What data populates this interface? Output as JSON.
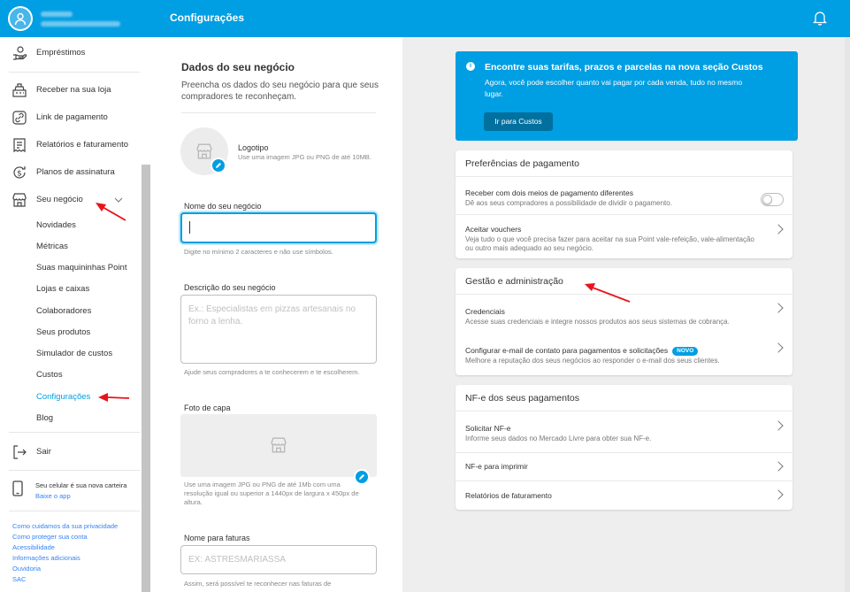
{
  "sidebar": {
    "items": [
      {
        "label": "Empréstimos",
        "icon": "hand-coin-icon"
      },
      {
        "label": "Receber na sua loja",
        "icon": "cash-register-icon"
      },
      {
        "label": "Link de pagamento",
        "icon": "link-icon"
      },
      {
        "label": "Relatórios e faturamento",
        "icon": "report-icon"
      },
      {
        "label": "Planos de assinatura",
        "icon": "dollar-cycle-icon"
      },
      {
        "label": "Seu negócio",
        "icon": "store-icon"
      }
    ],
    "sub_items": [
      "Novidades",
      "Métricas",
      "Suas maquininhas Point",
      "Lojas e caixas",
      "Colaboradores",
      "Seus produtos",
      "Simulador de custos",
      "Custos",
      "Configurações",
      "Blog"
    ],
    "active_sub": "Configurações",
    "logout_label": "Sair",
    "phone_promo": {
      "title": "Seu celular é sua nova carteira",
      "link": "Baixe o app"
    },
    "footer_links": [
      "Como cuidamos da sua privacidade",
      "Como proteger sua conta",
      "Acessibilidade",
      "Informações adicionais",
      "Ouvidoria",
      "SAC"
    ]
  },
  "header": {
    "title": "Configurações"
  },
  "form": {
    "title": "Dados do seu negócio",
    "subtitle": "Preencha os dados do seu negócio para que seus compradores te reconheçam.",
    "logo": {
      "label": "Logotipo",
      "help": "Use uma imagem JPG ou PNG de até 10MB."
    },
    "business_name": {
      "label": "Nome do seu negócio",
      "value": "",
      "help": "Digite no mínimo 2 caracteres e não use símbolos."
    },
    "description": {
      "label": "Descrição do seu negócio",
      "placeholder": "Ex.: Especialistas em pizzas artesanais no forno a lenha.",
      "help": "Ajude seus compradores a te conhecerem e te escolherem."
    },
    "cover": {
      "label": "Foto de capa",
      "help": "Use uma imagem JPG ou PNG de até 1Mb com uma resolução igual ou superior a 1440px de largura x 450px de altura."
    },
    "invoice_name": {
      "label": "Nome para faturas",
      "placeholder": "EX: ASTRESMARIASSA",
      "help": "Assim, será possível te reconhecer nas faturas de"
    }
  },
  "banner": {
    "title": "Encontre suas tarifas, prazos e parcelas na nova seção Custos",
    "text": "Agora, você pode escolher quanto vai pagar por cada venda, tudo no mesmo lugar.",
    "button": "Ir para Custos"
  },
  "payment_prefs": {
    "title": "Preferências de pagamento",
    "rows": [
      {
        "title": "Receber com dois meios de pagamento diferentes",
        "desc": "Dê aos seus compradores a possibilidade de dividir o pagamento.",
        "toggle": false
      },
      {
        "title": "Aceitar vouchers",
        "desc": "Veja tudo o que você precisa fazer para aceitar na sua Point vale-refeição, vale-alimentação ou outro mais adequado ao seu negócio."
      }
    ]
  },
  "management": {
    "title": "Gestão e administração",
    "rows": [
      {
        "title": "Credenciais",
        "desc": "Acesse suas credenciais e integre nossos produtos aos seus sistemas de cobrança."
      },
      {
        "title": "Configurar e-mail de contato para pagamentos e solicitações",
        "badge": "NOVO",
        "desc": "Melhore a reputação dos seus negócios ao responder o e-mail dos seus clientes."
      }
    ]
  },
  "nfe": {
    "title": "NF-e dos seus pagamentos",
    "rows": [
      {
        "title": "Solicitar NF-e",
        "desc": "Informe seus dados no Mercado Livre para obter sua NF-e."
      },
      {
        "title": "NF-e para imprimir"
      },
      {
        "title": "Relatórios de faturamento"
      }
    ]
  },
  "colors": {
    "brand": "#009ee3",
    "link": "#3483fa",
    "annotation": "#e8141b"
  }
}
